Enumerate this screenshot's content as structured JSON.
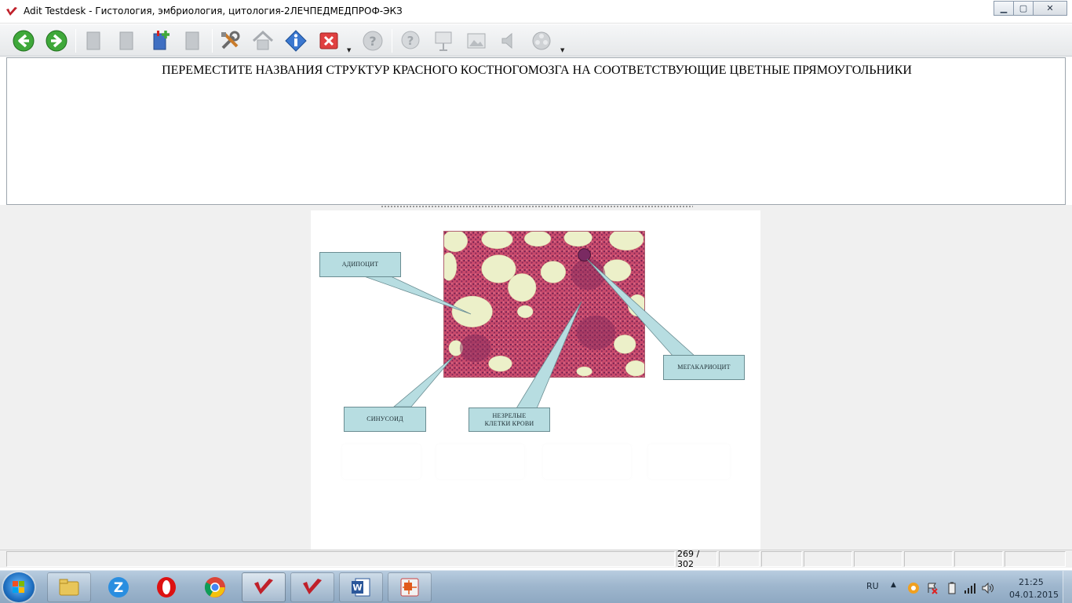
{
  "window": {
    "title": "Adit Testdesk - Гистология, эмбриология, цитология-2ЛЕЧПЕДМЕДПРОФ-ЭКЗ",
    "buttons": {
      "minimize": "▁",
      "maximize": "▢",
      "close": "✕"
    }
  },
  "toolbar": {
    "buttons": [
      "back-icon",
      "forward-icon",
      "page-icon",
      "page-icon",
      "add-page-icon",
      "page-icon",
      "tools-icon",
      "home-icon",
      "info-icon",
      "close-icon",
      "help-icon",
      "hint-icon",
      "presentation-icon",
      "image-icon",
      "sound-icon",
      "video-icon"
    ]
  },
  "question": {
    "text": "ПЕРЕМЕСТИТЕ  НАЗВАНИЯ СТРУКТУР КРАСНОГО КОСТНОГОМОЗГА НА СООТВЕТСТВУЮЩИЕ ЦВЕТНЫЕ ПРЯМОУГОЛЬНИКИ"
  },
  "labels": {
    "adipocyte": "АДИПОЦИТ",
    "megakaryocyte": "МЕГАКАРИОЦИТ",
    "sinusoid": "СИНУСОИД",
    "immature_line1": "НЕЗРЕЛЫЕ",
    "immature_line2": "КЛЕТКИ КРОВИ"
  },
  "status": {
    "counter": "269 / 302"
  },
  "taskbar": {
    "apps": [
      "explorer",
      "zoom-z",
      "opera",
      "chrome",
      "adit-testdesk",
      "adit-testdesk",
      "word",
      "presentation"
    ],
    "language": "RU",
    "time": "21:25",
    "date": "04.01.2015"
  },
  "colors": {
    "label_fill": "#b7dde1",
    "tissue": "#c9486a",
    "accent_green": "#3fa83a"
  }
}
